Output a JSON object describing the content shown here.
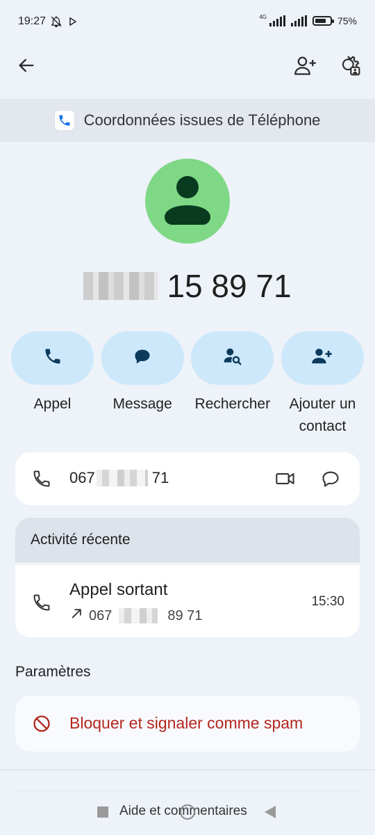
{
  "status_bar": {
    "time": "19:27",
    "network": "4G",
    "battery": "75%",
    "battery_level": 0.75
  },
  "top_bar": {
    "back_icon": "arrow-back-icon",
    "add_contact_icon": "person-add-icon",
    "settings_icon": "manage-accounts-icon"
  },
  "source_banner": {
    "text": "Coordonnées issues de Téléphone",
    "app_icon": "phone-app-icon"
  },
  "contact": {
    "phone_visible": "15 89 71"
  },
  "actions": [
    {
      "label": "Appel",
      "icon": "phone-icon"
    },
    {
      "label": "Message",
      "icon": "chat-bubble-icon"
    },
    {
      "label": "Rechercher",
      "icon": "person-search-icon"
    },
    {
      "label": "Ajouter un contact",
      "icon": "person-add-icon"
    }
  ],
  "number_card": {
    "prefix": "067",
    "suffix": "71"
  },
  "recent_activity": {
    "header": "Activité récente",
    "call_type": "Appel sortant",
    "call_prefix": "067",
    "call_suffix": "89 71",
    "time": "15:30"
  },
  "parameters": {
    "title": "Paramètres",
    "block_label": "Bloquer et signaler comme spam"
  },
  "footer": {
    "help": "Aide et commentaires"
  },
  "colors": {
    "background": "#eef2f9",
    "action_pill": "#cde8fb",
    "avatar_bg": "#7fd886",
    "icon_dark": "#0b3a5b",
    "danger": "#b3261e"
  }
}
